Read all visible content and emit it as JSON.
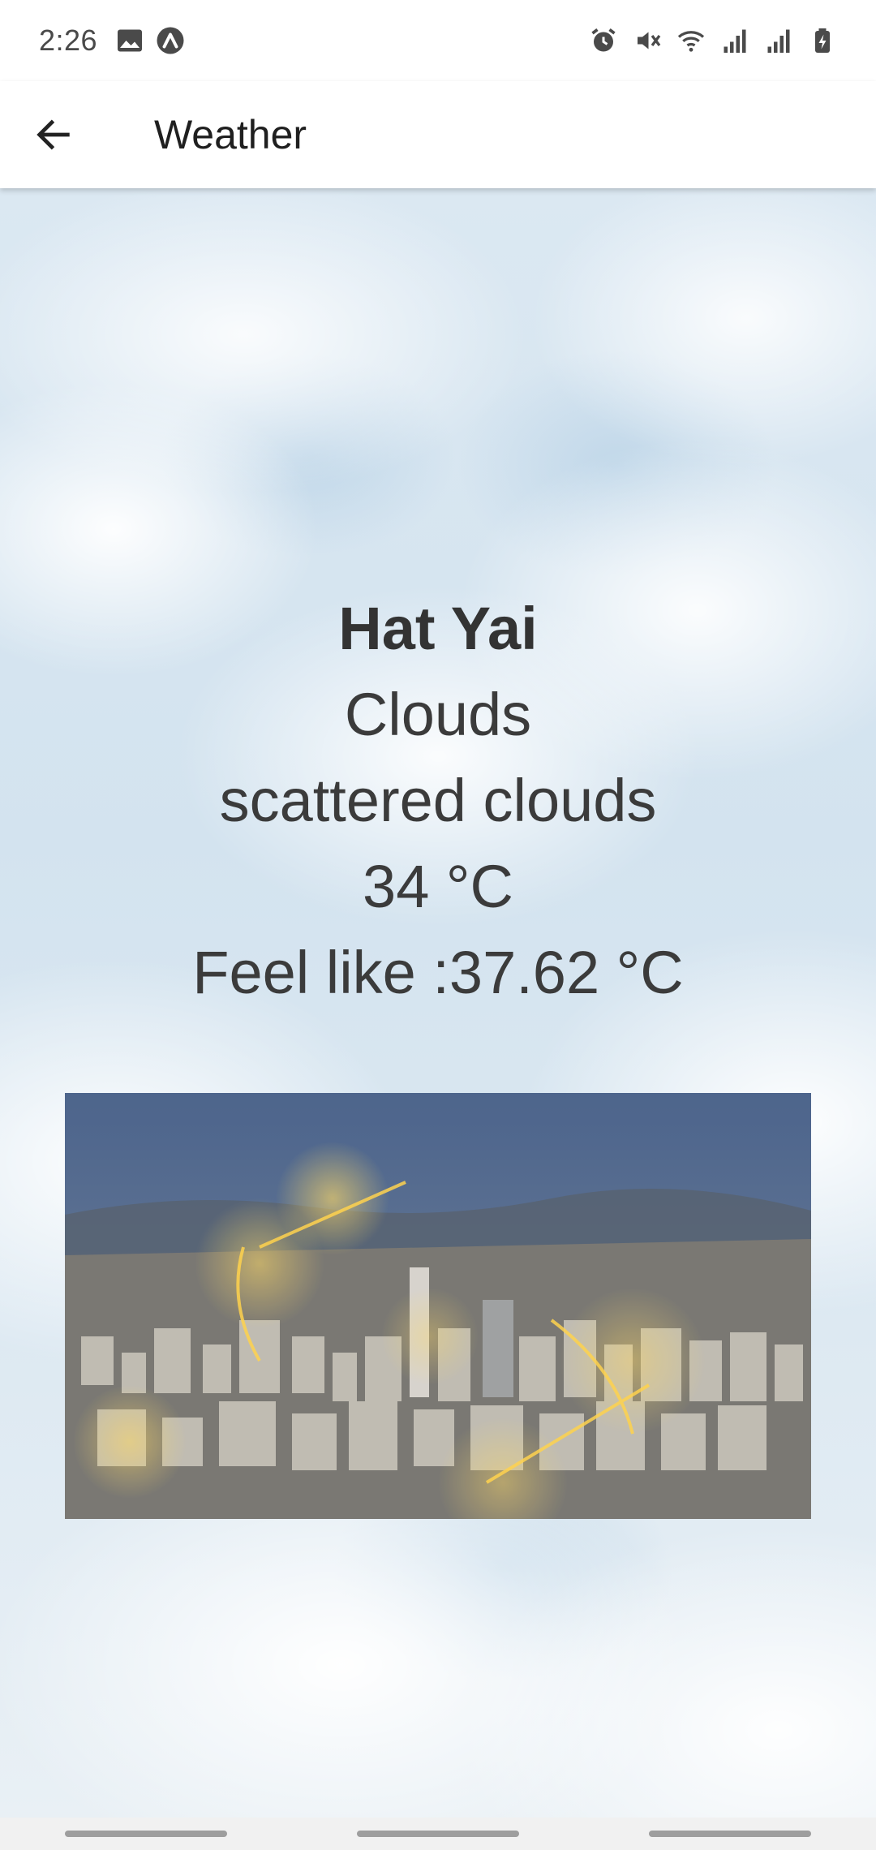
{
  "status_bar": {
    "time": "2:26",
    "left_icons": [
      "image-icon",
      "app-a-icon"
    ],
    "right_icons": [
      "alarm-icon",
      "mute-icon",
      "wifi-icon",
      "signal-icon",
      "signal-icon",
      "battery-charging-icon"
    ]
  },
  "app_bar": {
    "back_icon": "arrow-left-icon",
    "title": "Weather"
  },
  "weather": {
    "city": "Hat Yai",
    "condition": "Clouds",
    "description": "scattered clouds",
    "temperature": "34 °C",
    "feels_like": "Feel like :37.62 °C"
  },
  "colors": {
    "text_primary": "#333333",
    "background_sky": "#dbe8f2"
  }
}
